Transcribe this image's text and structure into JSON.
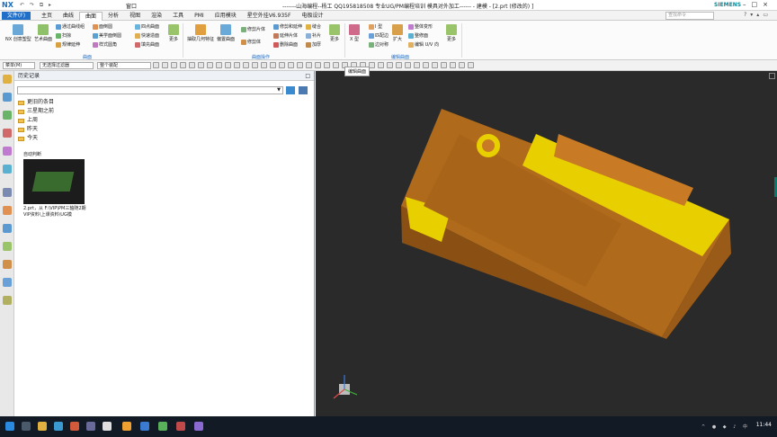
{
  "titlebar": {
    "logo": "NX",
    "window_menu": "窗口",
    "title": "-------山海编程--杨工  QQ195818508  专业UG/PM编程培训  模具对外加工------ - 建模 - [2.prt  (修改的)  ]",
    "brand": "SIEMENS"
  },
  "menu": {
    "file": "文件(F)",
    "tabs": [
      "主页",
      "曲线",
      "曲面",
      "分析",
      "视图",
      "渲染",
      "工具",
      "PMI",
      "应用模块",
      "星空外挂V6.935F",
      "电极设计"
    ],
    "active": "曲面",
    "search_placeholder": "查找命令"
  },
  "ribbon": {
    "b_nx": "NX 创意塑型",
    "b_art": "艺术曲面",
    "b_through": "通过曲线组",
    "b_ruled": "扫掠",
    "b_studio": "规律延伸",
    "b_swept": "面倒圆",
    "b_edge": "美学面倒圆",
    "b_style": "样式圆角",
    "b_four": "四点曲面",
    "b_fast": "快速造面",
    "b_fill": "填充曲面",
    "b_more1": "更多",
    "b_extract": "抽取几何特征",
    "b_offset": "偏置曲面",
    "b_trim": "修剪片体",
    "b_trim2": "修剪体",
    "b_split": "修剪和延伸",
    "b_extend": "延伸片体",
    "b_delete": "删除曲面",
    "b_patch": "缝合",
    "b_patch2": "补片",
    "b_thicken": "加厚",
    "b_more2": "更多",
    "b_x": "X 型",
    "b_i": "I 型",
    "b_match": "匹配边",
    "b_edgesym": "边对称",
    "b_enlarge": "扩大",
    "b_shape": "整体变形",
    "b_refit": "整修面",
    "b_uv": "编辑 U/V 向",
    "b_more3": "更多",
    "g1": "曲面",
    "g2": "曲面操作",
    "g3": "编辑曲面"
  },
  "tooltip": "编辑曲面",
  "cmdbar": {
    "menu_label": "菜单(M)",
    "filter": "无选择过滤器",
    "scope": "整个装配"
  },
  "nav": {
    "title": "历史记录",
    "folders": [
      "更旧的条目",
      "三星期之前",
      "上周",
      "昨天",
      "今天"
    ],
    "recent_label": "自动判断",
    "thumb_caption": "2.prt，从 F:\\VIP\\PM三轴随2期VIP资料\\上课资料\\UG模"
  },
  "taskbar": {
    "tray": "^ ● ◆ ♪ 中",
    "time": "11:44"
  },
  "colors": {
    "accent": "#1f6fc8",
    "viewport_bg": "#2a2a2a",
    "part": "#c97a25",
    "highlight": "#f5e300"
  }
}
